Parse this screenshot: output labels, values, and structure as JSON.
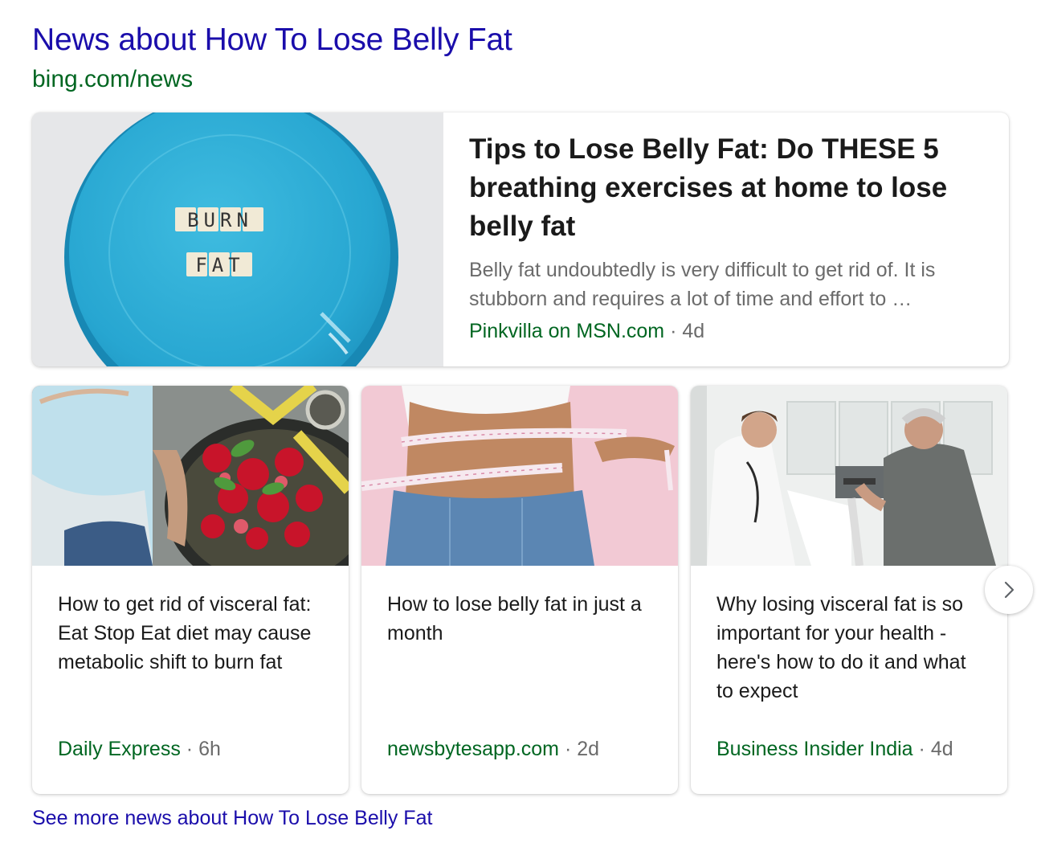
{
  "header": {
    "title": "News about How To Lose Belly Fat",
    "url": "bing.com/news"
  },
  "featured": {
    "title": "Tips to Lose Belly Fat: Do THESE 5 breathing exercises at home to lose belly fat",
    "snippet": "Belly fat undoubtedly is very difficult to get rid of. It is stubborn and requires a lot of time and effort to …",
    "source": "Pinkvilla on MSN.com",
    "separator": "·",
    "age": "4d",
    "image_text_line1": "BURN",
    "image_text_line2": "FAT"
  },
  "articles": [
    {
      "title": "How to get rid of visceral fat: Eat Stop Eat diet may cause metabolic shift to burn fat",
      "source": "Daily Express",
      "separator": "·",
      "age": "6h"
    },
    {
      "title": "How to lose belly fat in just a month",
      "source": "newsbytesapp.com",
      "separator": "·",
      "age": "2d"
    },
    {
      "title": "Why losing visceral fat is so important for your health - here's how to do it and what to expect",
      "source": "Business Insider India",
      "separator": "·",
      "age": "4d"
    }
  ],
  "carousel": {
    "next_icon": "chevron-right-icon"
  },
  "footer": {
    "see_more": "See more news about How To Lose Belly Fat"
  },
  "colors": {
    "link": "#1a0dab",
    "url_green": "#006621",
    "meta_gray": "#6b6b6b",
    "plate_blue": "#2aa9d2"
  }
}
